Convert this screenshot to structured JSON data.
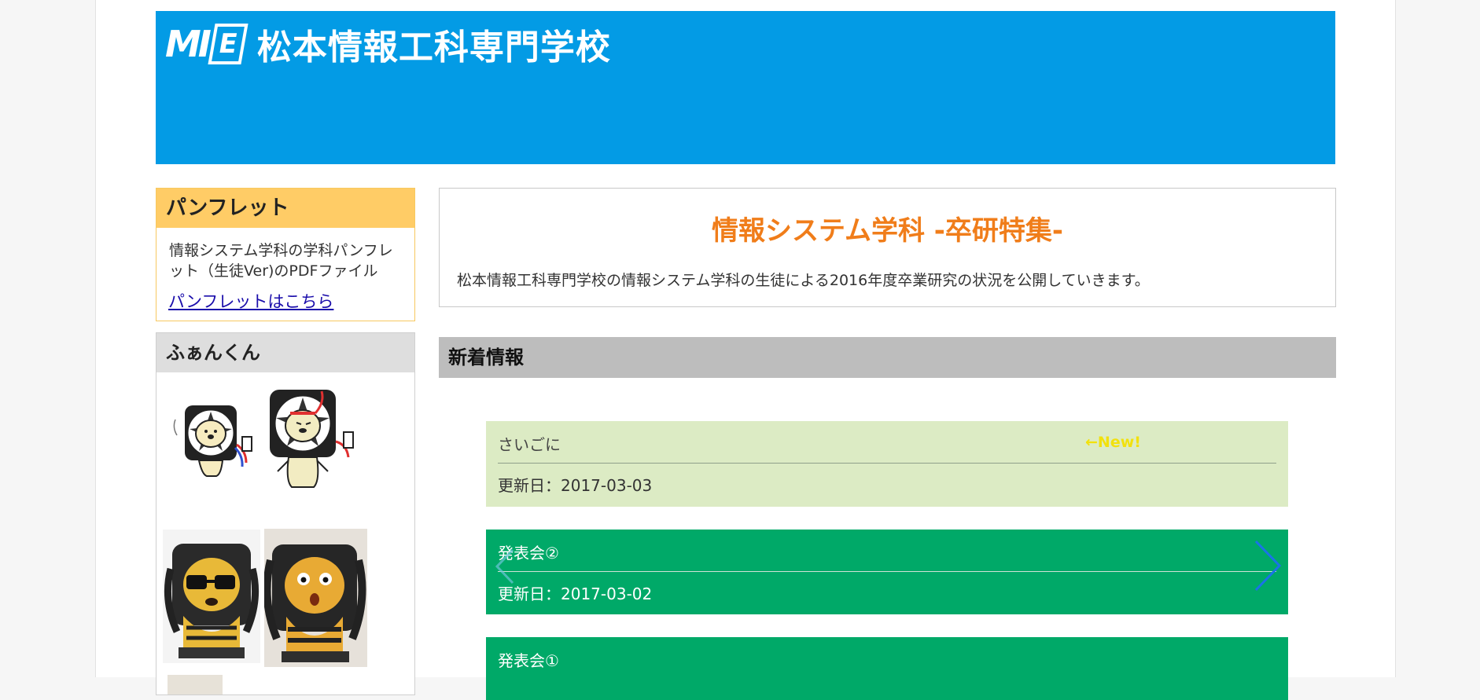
{
  "header": {
    "logo_mark": "MI",
    "logo_e": "E",
    "school_name": "松本情報工科専門学校",
    "bg_color": "#039be5"
  },
  "sidebar": {
    "pamphlet": {
      "title": "パンフレット",
      "description": "情報システム学科の学科パンフレット（生徒Ver)のPDFファイル",
      "link_text": "パンフレットはこちら",
      "header_color": "#ffcc66"
    },
    "fan": {
      "title": "ふぁんくん",
      "images": [
        "fan-mascot-drawing-small",
        "fan-mascot-drawing-standing",
        "fan-mascot-figure-glasses",
        "fan-mascot-figure-photo"
      ]
    }
  },
  "main": {
    "intro": {
      "title": "情報システム学科 -卒研特集-",
      "description": "松本情報工科専門学校の情報システム学科の生徒による2016年度卒業研究の状況を公開していきます。",
      "title_color": "#f07d1a"
    },
    "news": {
      "heading": "新着情報",
      "items": [
        {
          "title": "さいごに",
          "date": "更新日：2017-03-03",
          "badge": "←New!",
          "color": "#dcebc4"
        },
        {
          "title": "発表会②",
          "date": "更新日：2017-03-02",
          "color": "#00a968"
        },
        {
          "title": "発表会①",
          "color": "#00a968"
        }
      ],
      "carousel_prev": "prev-arrow-icon",
      "carousel_next": "next-arrow-icon"
    }
  }
}
